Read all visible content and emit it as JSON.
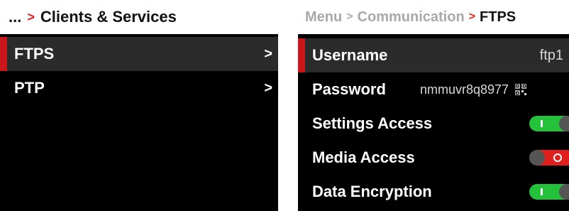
{
  "left_menu": {
    "breadcrumb": {
      "ellipsis": "...",
      "separator": ">",
      "current": "Clients & Services"
    },
    "items": [
      {
        "label": "FTPS",
        "chevron": ">",
        "selected": true
      },
      {
        "label": "PTP",
        "chevron": ">",
        "selected": false
      }
    ]
  },
  "right_menu": {
    "breadcrumb": {
      "root": "Menu",
      "separator": ">",
      "parent": "Communication",
      "current": "FTPS"
    },
    "username": {
      "label": "Username",
      "value": "ftp1"
    },
    "password": {
      "label": "Password",
      "value": "nmmuvr8q8977"
    },
    "settings_access": {
      "label": "Settings Access",
      "enabled": true
    },
    "media_access": {
      "label": "Media Access",
      "enabled": false
    },
    "data_encryption": {
      "label": "Data Encryption",
      "enabled": true
    }
  },
  "colors": {
    "accent": "#e0201c",
    "toggle_on": "#23c23a",
    "selected_row": "#2b2b2b",
    "background": "#000000"
  }
}
